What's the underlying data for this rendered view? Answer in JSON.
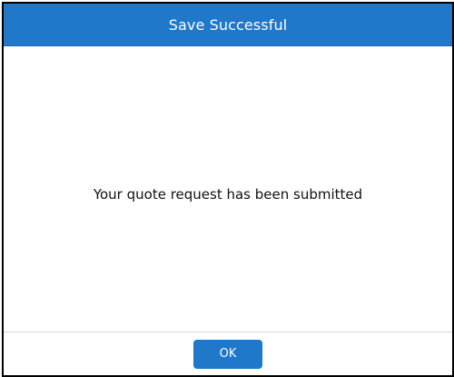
{
  "dialog": {
    "title": "Save Successful",
    "message": "Your quote request has been submitted",
    "ok_label": "OK"
  },
  "colors": {
    "accent": "#1f78c9",
    "border": "#000000",
    "divider": "#d9d9d9"
  }
}
